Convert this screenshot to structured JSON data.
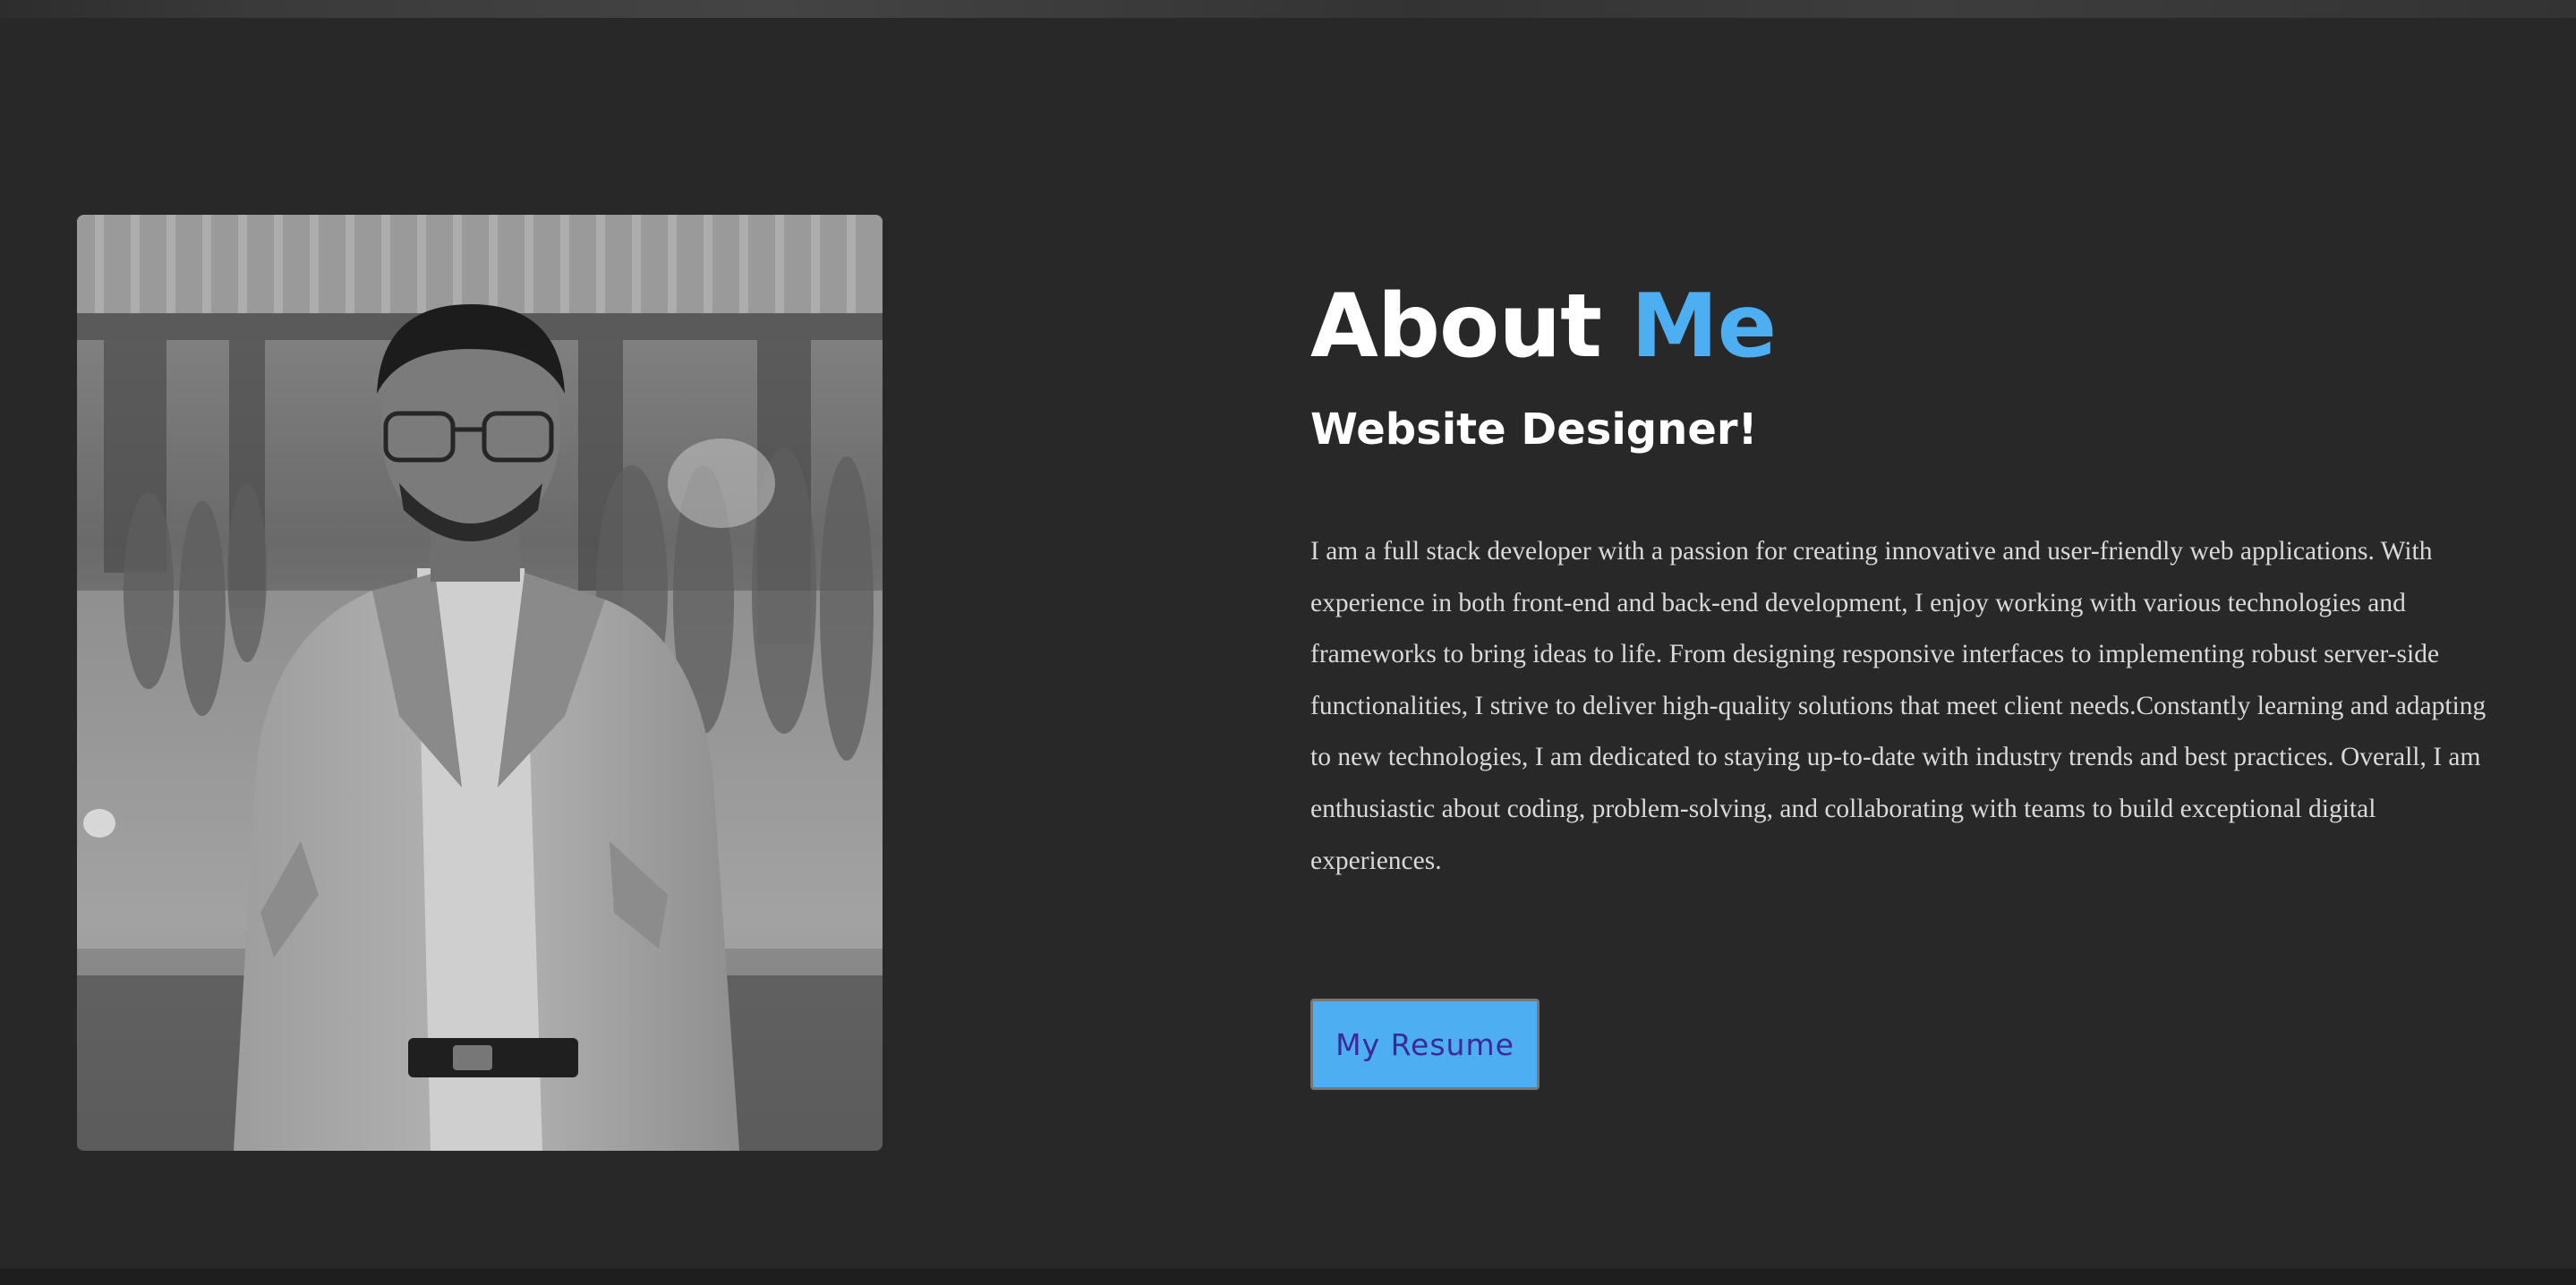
{
  "about": {
    "title_main": "About",
    "title_accent": "Me",
    "subtitle": "Website Designer!",
    "paragraph": "I am a full stack developer with a passion for creating innovative and user-friendly web applications. With experience in both front-end and back-end development, I enjoy working with various technologies and frameworks to bring ideas to life. From designing responsive interfaces to implementing robust server-side functionalities, I strive to deliver high-quality solutions that meet client needs.Constantly learning and adapting to new technologies, I am dedicated to staying up-to-date with industry trends and best practices. Overall, I am enthusiastic about coding, problem-solving, and collaborating with teams to build exceptional digital experiences."
  },
  "resume_button": {
    "label": "My Resume"
  },
  "colors": {
    "background": "#282828",
    "accent": "#4eaef2",
    "button_text": "#3a2a9a",
    "body_text": "#d9d9d9"
  }
}
